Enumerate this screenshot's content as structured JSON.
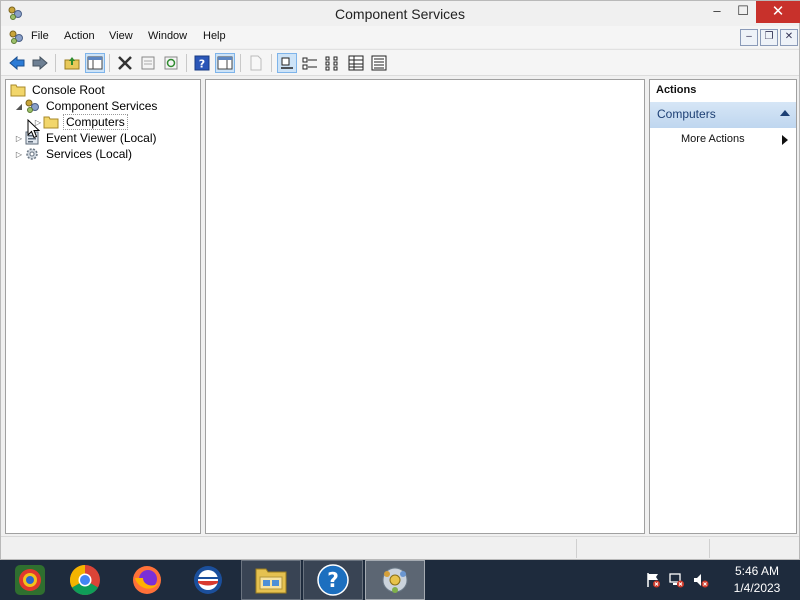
{
  "window": {
    "title": "Component Services",
    "controls": {
      "minimize": "–",
      "maximize": "☐",
      "close": "✕"
    }
  },
  "menu": {
    "items": [
      "File",
      "Action",
      "View",
      "Window",
      "Help"
    ],
    "mdi_controls": [
      "–",
      "❐",
      "✕"
    ]
  },
  "toolbar": {
    "buttons": [
      "back-icon",
      "forward-icon",
      "up-one-level-icon",
      "show-hide-console-tree-icon",
      "delete-icon",
      "properties-icon",
      "refresh-icon",
      "help-icon",
      "show-hide-action-pane-icon",
      "new-icon",
      "large-icons-view-icon",
      "small-icons-view-icon",
      "list-view-icon",
      "detail-view-icon",
      "status-view-icon"
    ],
    "active": [
      "show-hide-console-tree-icon",
      "show-hide-action-pane-icon",
      "large-icons-view-icon"
    ]
  },
  "tree": {
    "items": [
      {
        "label": "Console Root",
        "icon": "folder-icon",
        "level": 0,
        "expander": ""
      },
      {
        "label": "Component Services",
        "icon": "component-services-icon",
        "level": 1,
        "expander": "◢"
      },
      {
        "label": "Computers",
        "icon": "folder-icon",
        "level": 2,
        "expander": "▷",
        "selected": true
      },
      {
        "label": "Event Viewer (Local)",
        "icon": "event-viewer-icon",
        "level": 1,
        "expander": "▷"
      },
      {
        "label": "Services (Local)",
        "icon": "services-icon",
        "level": 1,
        "expander": "▷"
      }
    ]
  },
  "actions": {
    "header": "Actions",
    "group": "Computers",
    "more": "More Actions"
  },
  "taskbar": {
    "apps": [
      "start-orb-icon",
      "chrome-icon",
      "firefox-icon",
      "outlook-web-icon",
      "file-explorer-icon",
      "help-icon",
      "component-services-icon"
    ],
    "tray": [
      "action-center-icon",
      "network-icon",
      "volume-muted-icon"
    ],
    "time": "5:46 AM",
    "date": "1/4/2023"
  },
  "colors": {
    "accent": "#1c3f74",
    "close_red": "#c8312b",
    "taskbar": "#1e2b3d"
  }
}
